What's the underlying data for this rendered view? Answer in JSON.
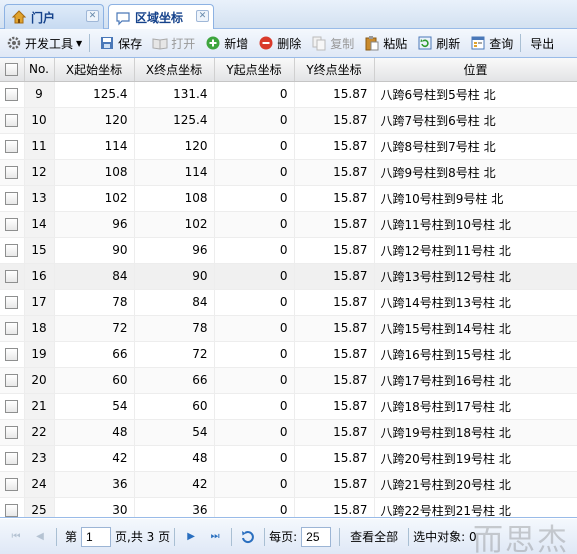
{
  "tabs": [
    {
      "label": "门户",
      "icon": "home-icon"
    },
    {
      "label": "区域坐标",
      "icon": "speech-bubble-icon"
    }
  ],
  "toolbar": {
    "dev_tools": "开发工具",
    "save": "保存",
    "open": "打开",
    "add": "新增",
    "delete": "删除",
    "copy": "复制",
    "paste": "粘贴",
    "refresh": "刷新",
    "query": "查询",
    "export": "导出"
  },
  "columns": {
    "no": "No.",
    "x_start": "X起始坐标",
    "x_end": "X终点坐标",
    "y_start": "Y起点坐标",
    "y_end": "Y终点坐标",
    "position": "位置"
  },
  "rows": [
    {
      "no": "9",
      "x_start": "125.4",
      "x_end": "131.4",
      "y_start": "0",
      "y_end": "15.87",
      "position": "八跨6号柱到5号柱 北"
    },
    {
      "no": "10",
      "x_start": "120",
      "x_end": "125.4",
      "y_start": "0",
      "y_end": "15.87",
      "position": "八跨7号柱到6号柱 北"
    },
    {
      "no": "11",
      "x_start": "114",
      "x_end": "120",
      "y_start": "0",
      "y_end": "15.87",
      "position": "八跨8号柱到7号柱 北"
    },
    {
      "no": "12",
      "x_start": "108",
      "x_end": "114",
      "y_start": "0",
      "y_end": "15.87",
      "position": "八跨9号柱到8号柱 北"
    },
    {
      "no": "13",
      "x_start": "102",
      "x_end": "108",
      "y_start": "0",
      "y_end": "15.87",
      "position": "八跨10号柱到9号柱 北"
    },
    {
      "no": "14",
      "x_start": "96",
      "x_end": "102",
      "y_start": "0",
      "y_end": "15.87",
      "position": "八跨11号柱到10号柱 北"
    },
    {
      "no": "15",
      "x_start": "90",
      "x_end": "96",
      "y_start": "0",
      "y_end": "15.87",
      "position": "八跨12号柱到11号柱 北"
    },
    {
      "no": "16",
      "x_start": "84",
      "x_end": "90",
      "y_start": "0",
      "y_end": "15.87",
      "position": "八跨13号柱到12号柱 北"
    },
    {
      "no": "17",
      "x_start": "78",
      "x_end": "84",
      "y_start": "0",
      "y_end": "15.87",
      "position": "八跨14号柱到13号柱 北"
    },
    {
      "no": "18",
      "x_start": "72",
      "x_end": "78",
      "y_start": "0",
      "y_end": "15.87",
      "position": "八跨15号柱到14号柱 北"
    },
    {
      "no": "19",
      "x_start": "66",
      "x_end": "72",
      "y_start": "0",
      "y_end": "15.87",
      "position": "八跨16号柱到15号柱 北"
    },
    {
      "no": "20",
      "x_start": "60",
      "x_end": "66",
      "y_start": "0",
      "y_end": "15.87",
      "position": "八跨17号柱到16号柱 北"
    },
    {
      "no": "21",
      "x_start": "54",
      "x_end": "60",
      "y_start": "0",
      "y_end": "15.87",
      "position": "八跨18号柱到17号柱 北"
    },
    {
      "no": "22",
      "x_start": "48",
      "x_end": "54",
      "y_start": "0",
      "y_end": "15.87",
      "position": "八跨19号柱到18号柱 北"
    },
    {
      "no": "23",
      "x_start": "42",
      "x_end": "48",
      "y_start": "0",
      "y_end": "15.87",
      "position": "八跨20号柱到19号柱 北"
    },
    {
      "no": "24",
      "x_start": "36",
      "x_end": "42",
      "y_start": "0",
      "y_end": "15.87",
      "position": "八跨21号柱到20号柱 北"
    },
    {
      "no": "25",
      "x_start": "30",
      "x_end": "36",
      "y_start": "0",
      "y_end": "15.87",
      "position": "八跨22号柱到21号柱 北"
    }
  ],
  "pager": {
    "page_prefix": "第",
    "current_page": "1",
    "page_suffix": "页,共 3 页",
    "per_page_label": "每页:",
    "per_page_value": "25",
    "view_all": "查看全部",
    "selected_label": "选中对象: 0"
  },
  "watermark": "而思杰",
  "colors": {
    "header_blue": "#15428b",
    "border_blue": "#99bbe8",
    "highlight_row": "#f0f0f0"
  }
}
